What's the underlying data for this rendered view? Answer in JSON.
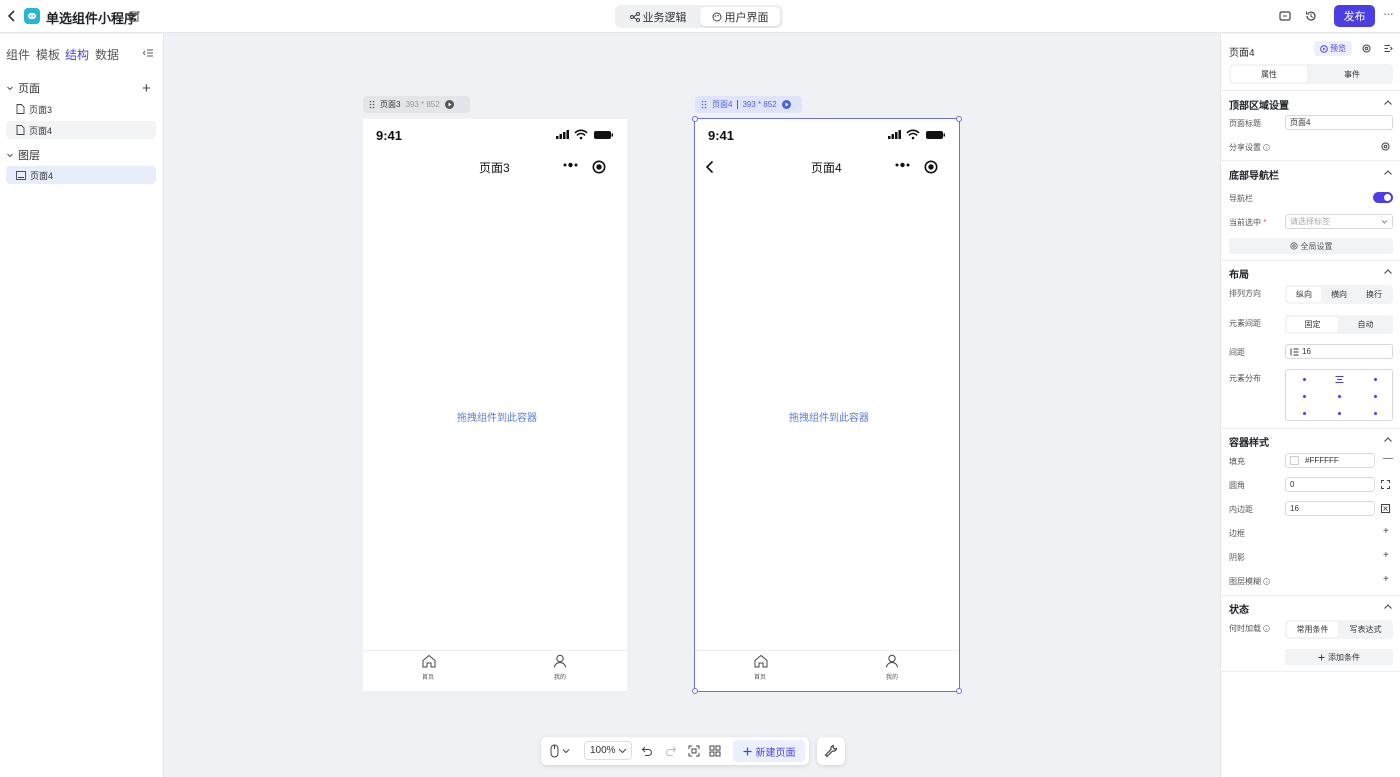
{
  "topbar": {
    "app_title": "单选组件小程序",
    "mode_tabs": [
      {
        "label": "业务逻辑"
      },
      {
        "label": "用户界面"
      }
    ],
    "publish_label": "发布",
    "more_label": "···"
  },
  "left_panel": {
    "tabs": [
      "组件",
      "模板",
      "结构",
      "数据"
    ],
    "active_tab": "结构",
    "pages_heading": "页面",
    "add_symbol": "+",
    "pages": [
      "页面3",
      "页面4"
    ],
    "layers_heading": "图层",
    "layers": [
      "页面4"
    ]
  },
  "canvas": {
    "frames": [
      {
        "name": "页面3",
        "size": "393 * 852",
        "time": "9:41",
        "nav_title": "页面3",
        "placeholder": "拖拽组件到此容器",
        "tabs": [
          "首页",
          "我的"
        ],
        "selected": false
      },
      {
        "name": "页面4",
        "size": "393 * 852",
        "time": "9:41",
        "nav_title": "页面4",
        "placeholder": "拖拽组件到此容器",
        "tabs": [
          "首页",
          "我的"
        ],
        "selected": true
      }
    ]
  },
  "bottom_toolbar": {
    "zoom": "100%",
    "new_page_label": "新建页面"
  },
  "right_panel": {
    "title": "页面4",
    "preview_label": "预览",
    "tabs": [
      "属性",
      "事件"
    ],
    "active_tab": "属性",
    "top_area": {
      "heading": "顶部区域设置",
      "page_title_label": "页面标题",
      "page_title_value": "页面4",
      "share_label": "分享设置"
    },
    "bottom_nav": {
      "heading": "底部导航栏",
      "nav_label": "导航栏",
      "nav_enabled": true,
      "current_label": "当前选中",
      "current_placeholder": "请选择标签",
      "global_settings_label": "全局设置"
    },
    "layout": {
      "heading": "布局",
      "direction_label": "排列方向",
      "direction_options": [
        "纵向",
        "横向",
        "换行"
      ],
      "direction_selected": "纵向",
      "spacing_mode_label": "元素间距",
      "spacing_mode_options": [
        "固定",
        "自动"
      ],
      "spacing_mode_selected": "固定",
      "gap_label": "间距",
      "gap_value": "16",
      "distribution_label": "元素分布"
    },
    "container_style": {
      "heading": "容器样式",
      "fill_label": "填充",
      "fill_value": "#FFFFFF",
      "radius_label": "圆角",
      "radius_value": "0",
      "padding_label": "内边距",
      "padding_value": "16",
      "border_label": "边框",
      "shadow_label": "阴影",
      "blur_label": "图层模糊",
      "add_symbol": "+",
      "minus_symbol": "—"
    },
    "state": {
      "heading": "状态",
      "load_label": "何时加载",
      "load_options": [
        "常用条件",
        "写表达式"
      ],
      "load_selected": "常用条件",
      "add_condition_label": "添加条件"
    }
  },
  "colors": {
    "accent": "#4b3fe3",
    "logo": "#29b5d6",
    "canvas_bg": "#f0f1f5",
    "placeholder": "#5b7cd6"
  }
}
